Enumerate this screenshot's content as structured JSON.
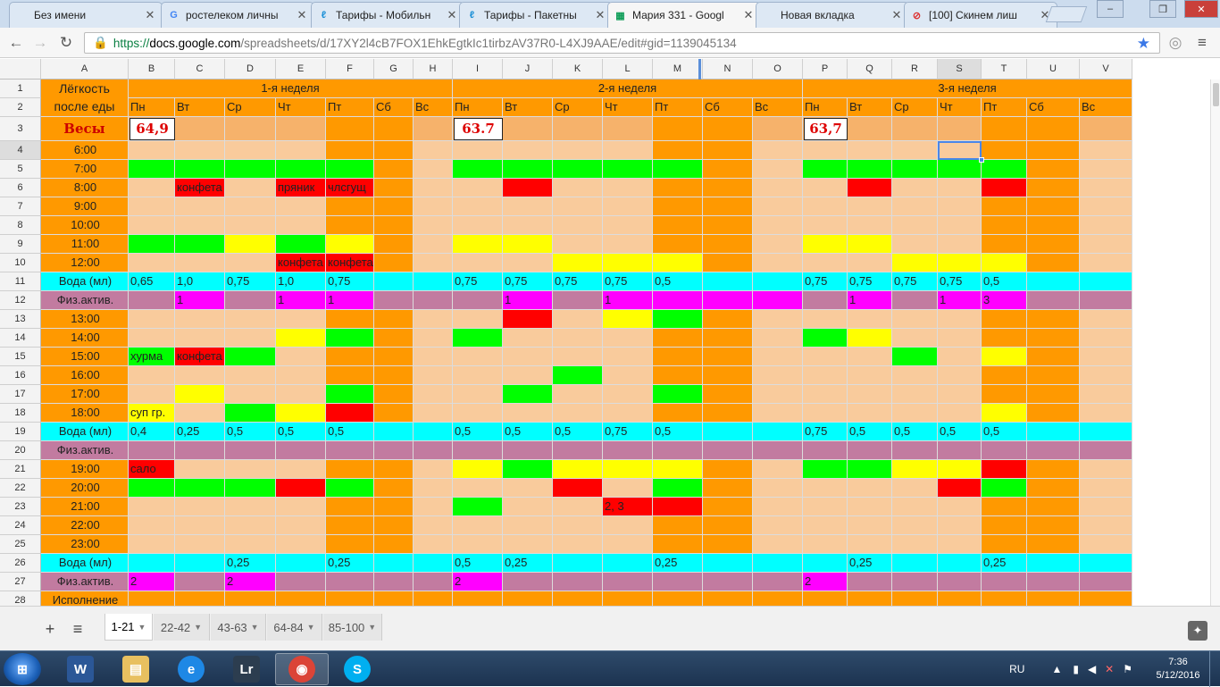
{
  "browser": {
    "tabs": [
      {
        "title": "Без имени",
        "icon": "blank"
      },
      {
        "title": "ростелеком личны",
        "icon": "google"
      },
      {
        "title": "Тарифы - Мобильн",
        "icon": "rostelecom"
      },
      {
        "title": "Тарифы - Пакетны",
        "icon": "rostelecom"
      },
      {
        "title": "Мария 331 - Googl",
        "icon": "sheets"
      },
      {
        "title": "Новая вкладка",
        "icon": "blank"
      },
      {
        "title": "[100] Скинем лиш",
        "icon": "forum"
      }
    ],
    "active_tab": 4,
    "url_scheme": "https://",
    "url_host": "docs.google.com",
    "url_path": "/spreadsheets/d/17XY2l4cB7FOX1EhkEgtkIc1tirbzAV37R0-L4XJ9AAE/edit#gid=1139045134",
    "window_buttons": [
      "–",
      "❐",
      "✕"
    ]
  },
  "grid": {
    "columns": [
      "A",
      "B",
      "C",
      "D",
      "E",
      "F",
      "G",
      "H",
      "I",
      "J",
      "K",
      "L",
      "M",
      "N",
      "O",
      "P",
      "Q",
      "R",
      "S",
      "T",
      "U",
      "V"
    ],
    "header_a": "Лёгкость после еды",
    "weeks": [
      "1-я неделя",
      "2-я неделя",
      "3-я неделя"
    ],
    "days": [
      "Пн",
      "Вт",
      "Ср",
      "Чт",
      "Пт",
      "Сб",
      "Вс"
    ],
    "weight_label": "Весы",
    "weights": [
      "64,9",
      "63.7",
      "63,7"
    ],
    "rows": [
      {
        "label": "6:00",
        "type": "t",
        "cells": {}
      },
      {
        "label": "7:00",
        "type": "t",
        "cells": {
          "B": "G",
          "C": "G",
          "D": "G",
          "E": "G",
          "F": "G",
          "I": "G",
          "J": "G",
          "K": "G",
          "L": "G",
          "M": "G",
          "P": "G",
          "Q": "G",
          "R": "G",
          "S": "G",
          "T": "G"
        }
      },
      {
        "label": "8:00",
        "type": "t",
        "cells": {
          "C": "R:конфета",
          "E": "R:пряник",
          "F": "R:члсгущ",
          "J": "R",
          "Q": "R",
          "T": "R"
        }
      },
      {
        "label": "9:00",
        "type": "t",
        "cells": {}
      },
      {
        "label": "10:00",
        "type": "t",
        "cells": {}
      },
      {
        "label": "11:00",
        "type": "t",
        "cells": {
          "B": "G",
          "C": "G",
          "D": "Y",
          "E": "G",
          "F": "Y",
          "I": "Y",
          "J": "Y",
          "P": "Y",
          "Q": "Y"
        }
      },
      {
        "label": "12:00",
        "type": "t",
        "cells": {
          "E": "R:конфета",
          "F": "R:конфета",
          "K": "Y",
          "L": "Y",
          "M": "Y",
          "R": "Y",
          "S": "Y",
          "T": "Y"
        }
      },
      {
        "label": "Вода (мл)",
        "type": "w",
        "cells": {
          "B": "0,65",
          "C": "1,0",
          "D": "0,75",
          "E": "1,0",
          "F": "0,75",
          "I": "0,75",
          "J": "0,75",
          "K": "0,75",
          "L": "0,75",
          "M": "0,5",
          "P": "0,75",
          "Q": "0,75",
          "R": "0,75",
          "S": "0,75",
          "T": "0,5"
        }
      },
      {
        "label": "Физ.актив.",
        "type": "p",
        "cells": {
          "C": "1",
          "E": "1",
          "F": "1",
          "J": "1",
          "L": "1",
          "Q": "1",
          "S": "1",
          "T": "3"
        },
        "magenta": [
          "C",
          "E",
          "F",
          "J",
          "L",
          "M",
          "N",
          "O",
          "Q",
          "S",
          "T"
        ]
      },
      {
        "label": "13:00",
        "type": "t",
        "cells": {
          "J": "R",
          "L": "Y",
          "M": "G"
        }
      },
      {
        "label": "14:00",
        "type": "t",
        "cells": {
          "E": "Y",
          "F": "G",
          "I": "G",
          "P": "G",
          "Q": "Y"
        }
      },
      {
        "label": "15:00",
        "type": "t",
        "cells": {
          "B": "G:хурма",
          "C": "R:конфета",
          "D": "G",
          "R": "G",
          "T": "Y"
        }
      },
      {
        "label": "16:00",
        "type": "t",
        "cells": {
          "K": "G"
        }
      },
      {
        "label": "17:00",
        "type": "t",
        "cells": {
          "C": "Y",
          "F": "G",
          "J": "G",
          "M": "G"
        }
      },
      {
        "label": "18:00",
        "type": "t",
        "cells": {
          "B": "Y:суп гр.",
          "D": "G",
          "E": "Y",
          "F": "R",
          "T": "Y"
        }
      },
      {
        "label": "Вода (мл)",
        "type": "w",
        "cells": {
          "B": "0,4",
          "C": "0,25",
          "D": "0,5",
          "E": "0,5",
          "F": "0,5",
          "I": "0,5",
          "J": "0,5",
          "K": "0,5",
          "L": "0,75",
          "M": "0,5",
          "P": "0,75",
          "Q": "0,5",
          "R": "0,5",
          "S": "0,5",
          "T": "0,5"
        }
      },
      {
        "label": "Физ.актив.",
        "type": "p",
        "cells": {},
        "magenta": []
      },
      {
        "label": "19:00",
        "type": "t",
        "cells": {
          "B": "R:сало",
          "I": "Y",
          "J": "G",
          "K": "Y",
          "L": "Y",
          "M": "Y",
          "P": "G",
          "Q": "G",
          "R": "Y",
          "S": "Y",
          "T": "R"
        }
      },
      {
        "label": "20:00",
        "type": "t",
        "cells": {
          "B": "G",
          "C": "G",
          "D": "G",
          "E": "R",
          "F": "G",
          "K": "R",
          "M": "G",
          "S": "R",
          "T": "G"
        }
      },
      {
        "label": "21:00",
        "type": "t",
        "cells": {
          "I": "G",
          "L": "R:2, 3",
          "M": "R"
        }
      },
      {
        "label": "22:00",
        "type": "t",
        "cells": {}
      },
      {
        "label": "23:00",
        "type": "t",
        "cells": {}
      },
      {
        "label": "Вода (мл)",
        "type": "w",
        "cells": {
          "D": "0,25",
          "F": "0,25",
          "I": "0,5",
          "J": "0,25",
          "M": "0,25",
          "Q": "0,25",
          "T": "0,25"
        }
      },
      {
        "label": "Физ.актив.",
        "type": "p",
        "cells": {
          "B": "2",
          "D": "2",
          "I": "2",
          "P": "2"
        },
        "magenta": [
          "B",
          "D",
          "I",
          "P"
        ]
      }
    ],
    "last_row_label": "Исполнение",
    "selected_cell": "S4",
    "colors": {
      "orange": "#ff9900",
      "peach": "#f9cb9c",
      "light_orange": "#f6b26b",
      "green": "#00ff00",
      "yellow": "#ffff00",
      "red": "#ff0000",
      "cyan": "#00ffff",
      "mauve": "#c27ba0",
      "magenta": "#ff00ff",
      "red_text": "#cc0000",
      "selection": "#4a86e8"
    }
  },
  "sheets": {
    "tabs": [
      "1-21",
      "22-42",
      "43-63",
      "64-84",
      "85-100"
    ],
    "active": 0,
    "add_label": "+",
    "list_label": "≡"
  },
  "taskbar": {
    "start_label": "",
    "apps": [
      {
        "name": "word",
        "glyph": "W",
        "color": "#2b5797",
        "active": false
      },
      {
        "name": "explorer",
        "glyph": "▤",
        "color": "#e8c060",
        "active": false
      },
      {
        "name": "ie",
        "glyph": "e",
        "color": "#1e88e5",
        "active": false
      },
      {
        "name": "lightroom",
        "glyph": "Lr",
        "color": "#2c3d4f",
        "active": false
      },
      {
        "name": "chrome",
        "glyph": "◉",
        "color": "#db4437",
        "active": true
      },
      {
        "name": "skype",
        "glyph": "S",
        "color": "#00aff0",
        "active": false
      }
    ],
    "lang": "RU",
    "time": "7:36",
    "date": "5/12/2016"
  }
}
